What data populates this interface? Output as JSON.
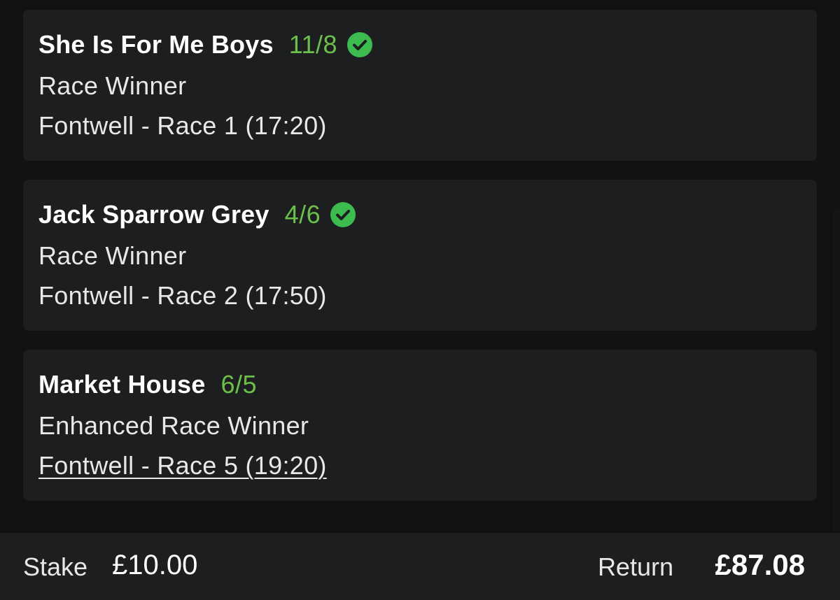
{
  "selections": [
    {
      "runner": "She Is For Me Boys",
      "odds": "11/8",
      "settled_icon": "check-circle-icon",
      "market": "Race Winner",
      "event": "Fontwell - Race 1 (17:20)"
    },
    {
      "runner": "Jack Sparrow Grey",
      "odds": "4/6",
      "settled_icon": "check-circle-icon",
      "market": "Race Winner",
      "event": "Fontwell - Race 2 (17:50)"
    },
    {
      "runner": "Market House",
      "odds": "6/5",
      "market": "Enhanced Race Winner",
      "event": "Fontwell - Race 5 (19:20)"
    }
  ],
  "footer": {
    "stake_label": "Stake",
    "stake_value": "£10.00",
    "return_label": "Return",
    "return_value": "£87.08"
  },
  "colors": {
    "odds_green": "#6cc04a",
    "check_green": "#3dbb4e",
    "card_bg": "#1d1e20",
    "page_bg": "#111213"
  }
}
